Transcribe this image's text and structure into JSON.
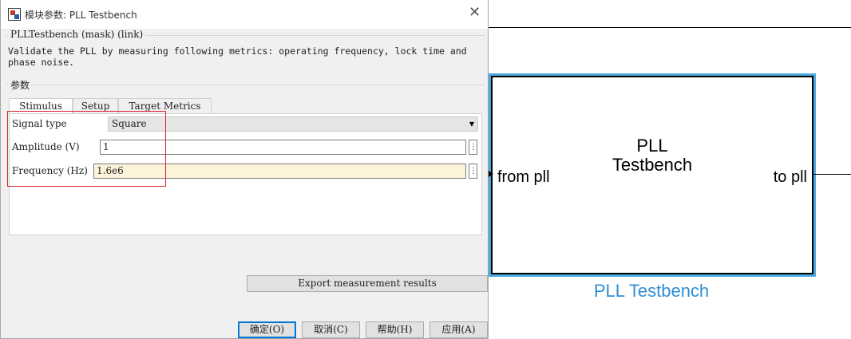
{
  "dialog": {
    "title": "模块参数: PLL Testbench",
    "close_glyph": "✕",
    "mask_header": "PLLTestbench (mask) (link)",
    "description": "Validate the PLL by measuring following metrics: operating frequency, lock time and phase noise.",
    "params_group": "参数",
    "tabs": [
      {
        "label": "Stimulus",
        "active": true
      },
      {
        "label": "Setup",
        "active": false
      },
      {
        "label": "Target Metrics",
        "active": false
      }
    ],
    "fields": {
      "signal_type": {
        "label": "Signal type",
        "value": "Square"
      },
      "amplitude": {
        "label": "Amplitude (V)",
        "value": "1"
      },
      "frequency": {
        "label": "Frequency (Hz)",
        "value": "1.6e6"
      }
    },
    "kebab_glyph": "⋮",
    "caret_glyph": "▼",
    "export_button": "Export measurement results",
    "buttons": {
      "ok": "确定(O)",
      "cancel": "取消(C)",
      "help": "帮助(H)",
      "apply": "应用(A)"
    }
  },
  "block": {
    "title_line1": "PLL",
    "title_line2": "Testbench",
    "port_in": "from pll",
    "port_out": "to pll",
    "name": "PLL Testbench"
  },
  "colors": {
    "selection": "#49a8e0",
    "block_name": "#2f8fd6",
    "highlight_box": "#d8262e",
    "default_button_border": "#0078d7",
    "field_highlight": "#fdf2da"
  }
}
